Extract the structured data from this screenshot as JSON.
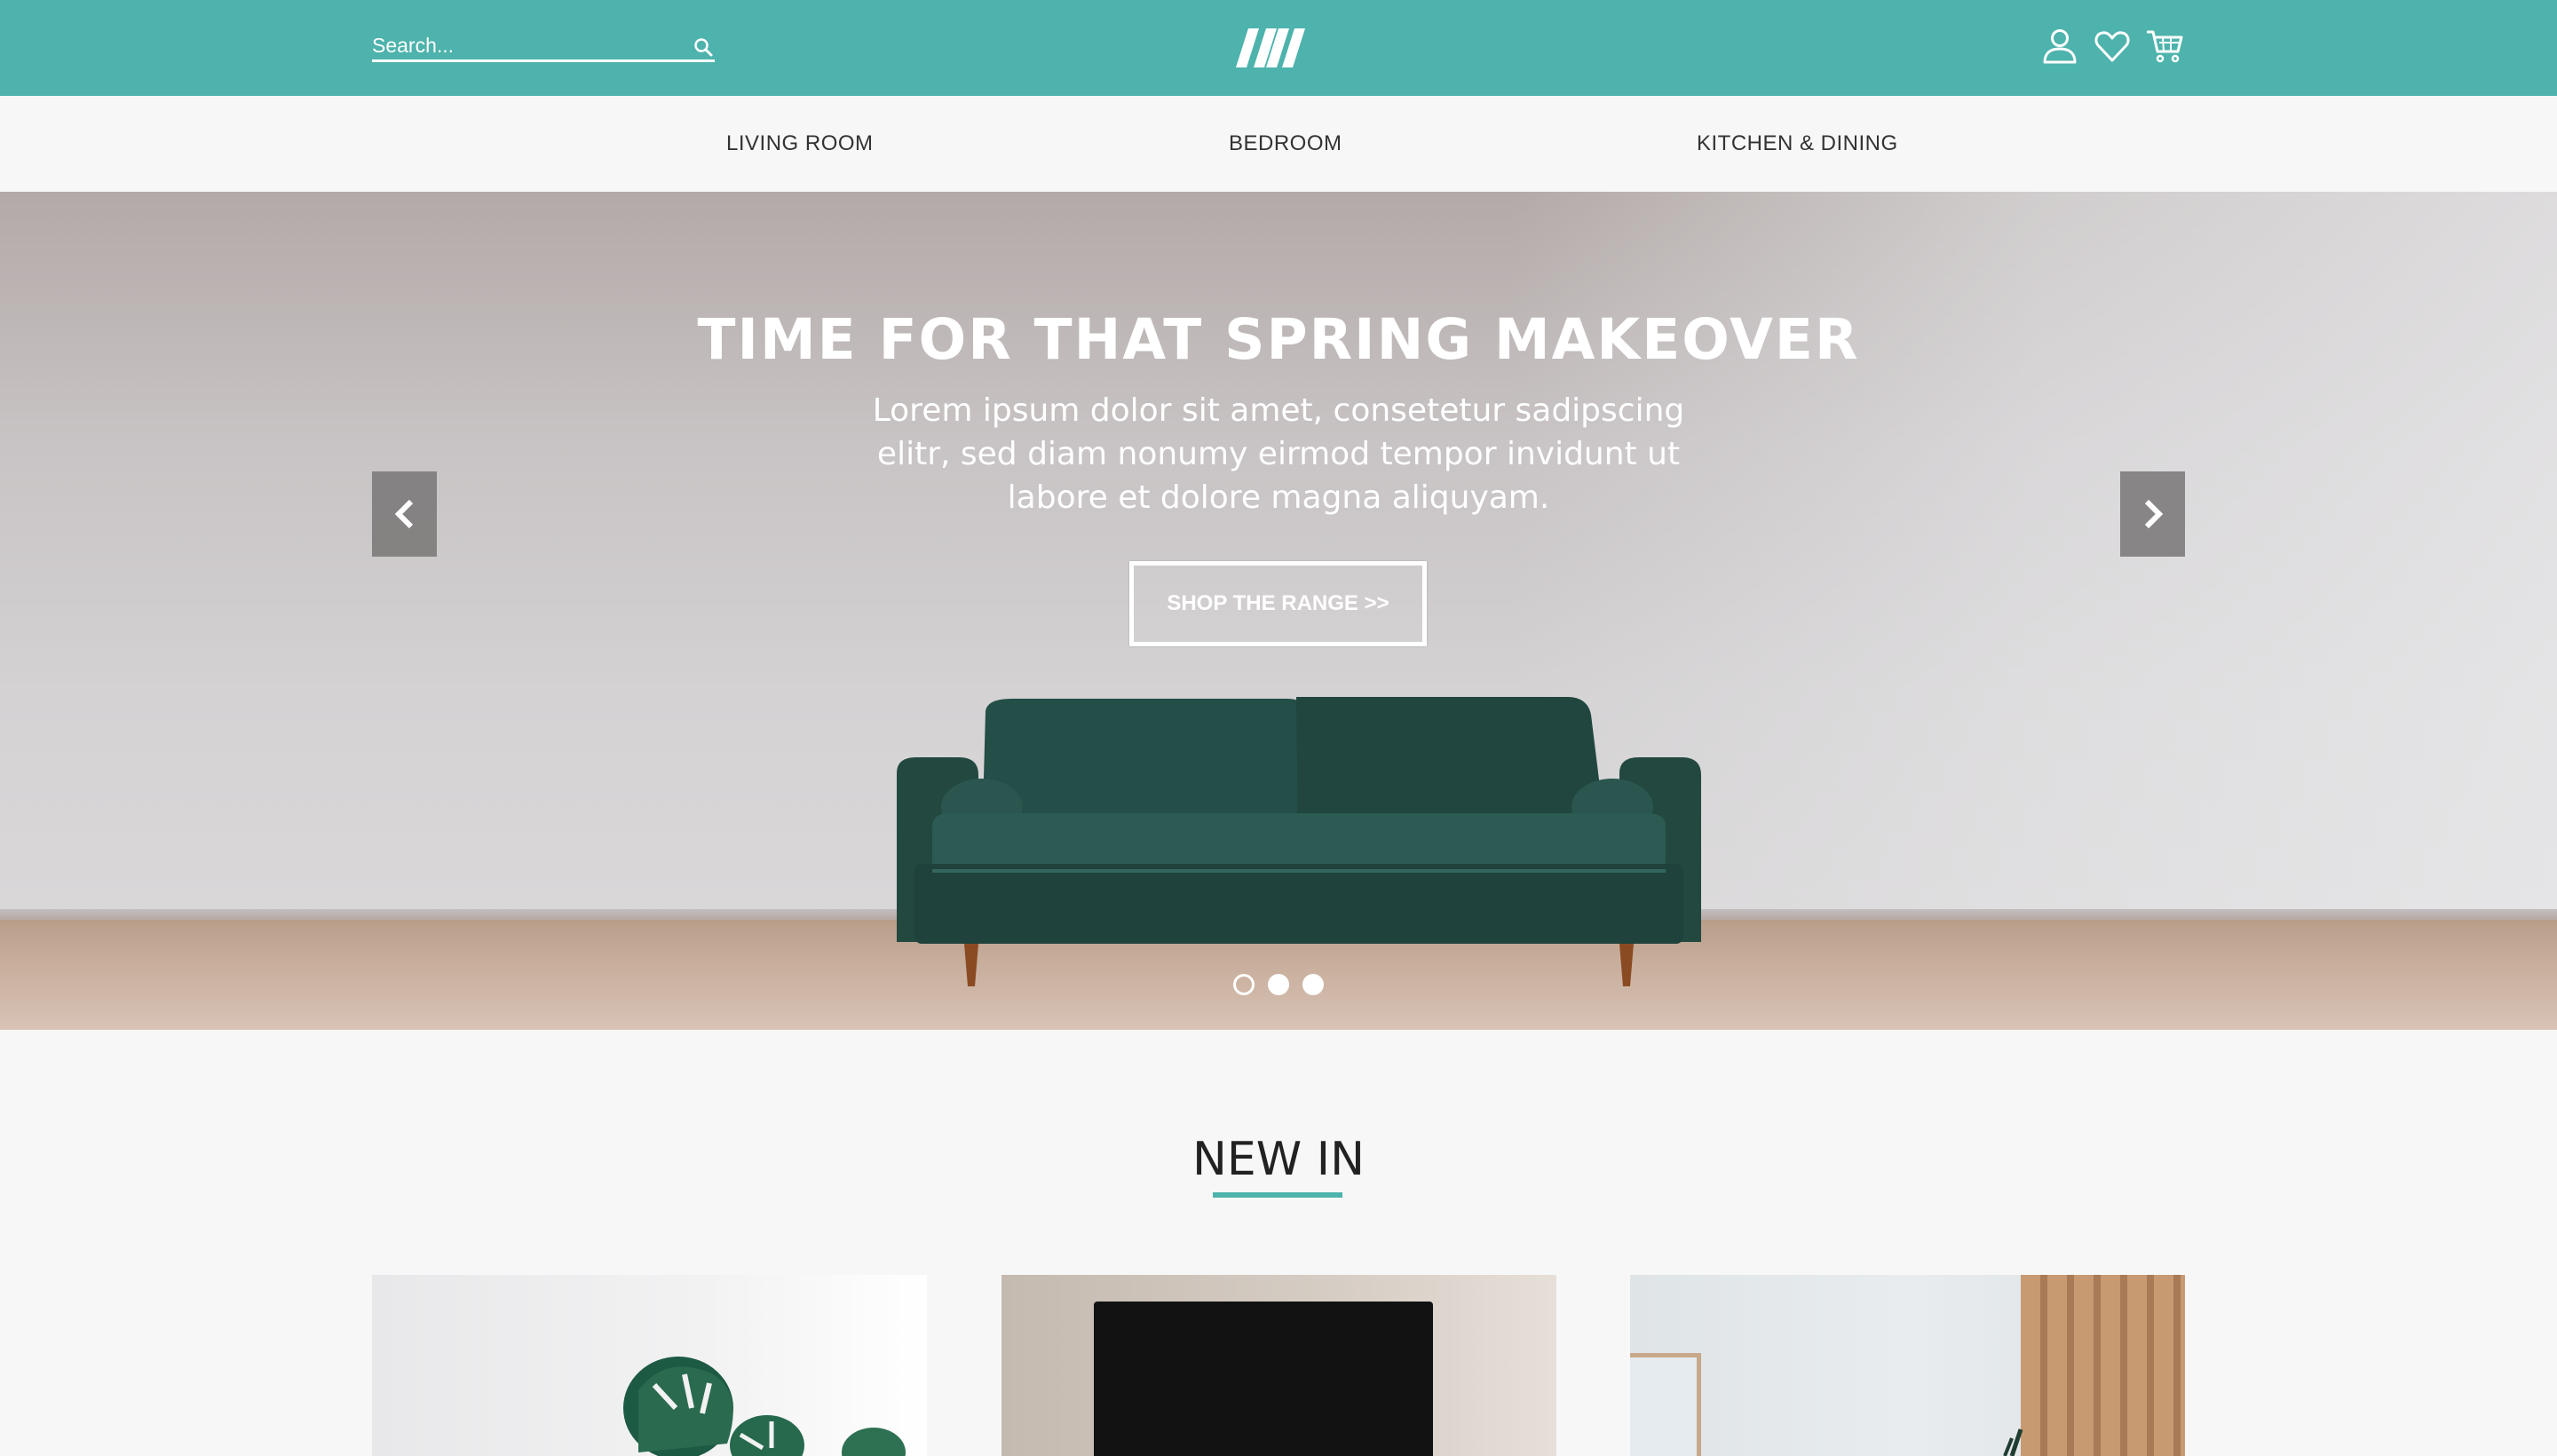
{
  "header": {
    "search_placeholder": "Search...",
    "search_icon": "search-icon",
    "logo_icon": "brand-logo",
    "icons": [
      "user-icon",
      "heart-icon",
      "cart-icon"
    ],
    "accent_color": "#4db3ac"
  },
  "nav": {
    "items": [
      {
        "label": "LIVING ROOM"
      },
      {
        "label": "BEDROOM"
      },
      {
        "label": "KITCHEN & DINING"
      }
    ]
  },
  "hero": {
    "title": "TIME FOR THAT SPRING MAKEOVER",
    "subtitle": "Lorem ipsum dolor sit amet, consetetur sadipscing elitr, sed diam nonumy eirmod tempor invidunt ut labore et dolore magna aliquyam.",
    "cta_label": "SHOP THE RANGE >>",
    "prev_icon": "chevron-left-icon",
    "next_icon": "chevron-right-icon",
    "slide_count": 3,
    "active_slide": 1
  },
  "new_in": {
    "title": "NEW IN"
  }
}
